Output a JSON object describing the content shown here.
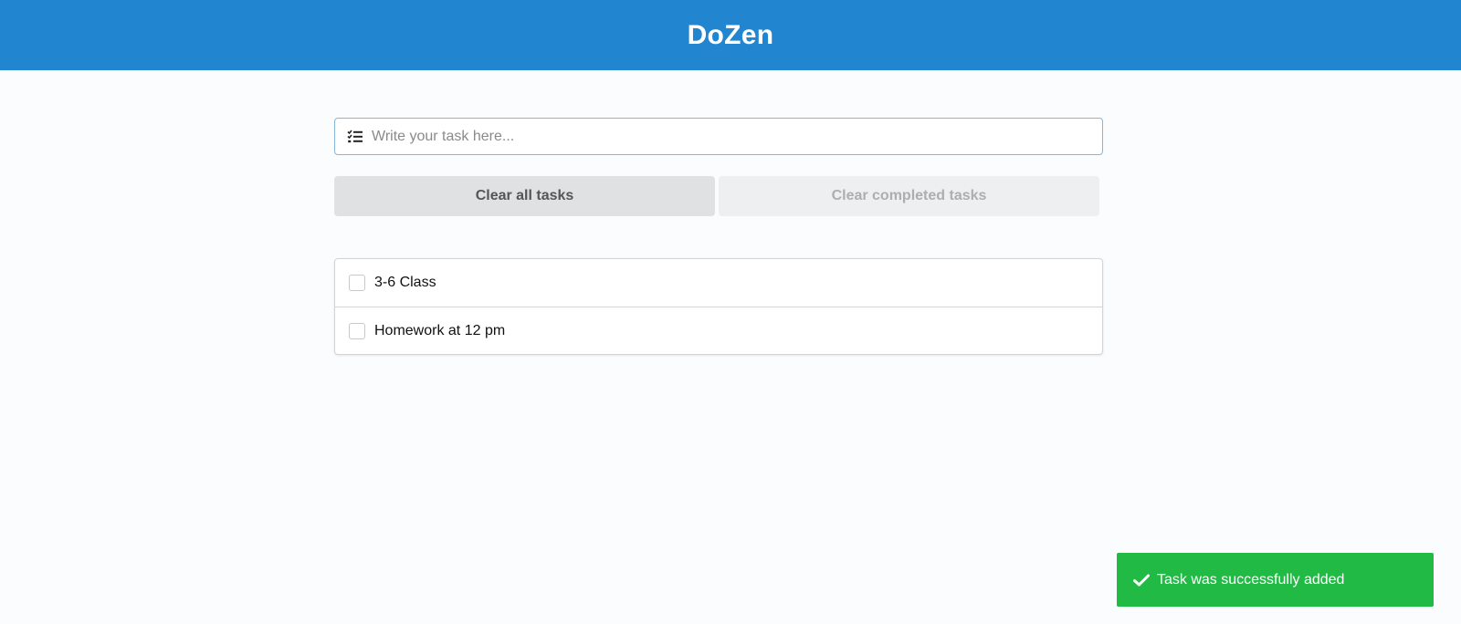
{
  "header": {
    "title": "DoZen",
    "background_color": "#2185d0"
  },
  "task_input": {
    "icon": "tasks-list-icon",
    "value": "",
    "placeholder": "Write your task here..."
  },
  "actions": {
    "clear_all_label": "Clear all tasks",
    "clear_completed_label": "Clear completed tasks",
    "clear_completed_disabled": true
  },
  "tasks": [
    {
      "label": "3-6 Class",
      "completed": false
    },
    {
      "label": "Homework at 12 pm",
      "completed": false
    }
  ],
  "toast": {
    "icon": "checkmark-icon",
    "message": "Task was successfully added",
    "color": "#21ba45"
  }
}
